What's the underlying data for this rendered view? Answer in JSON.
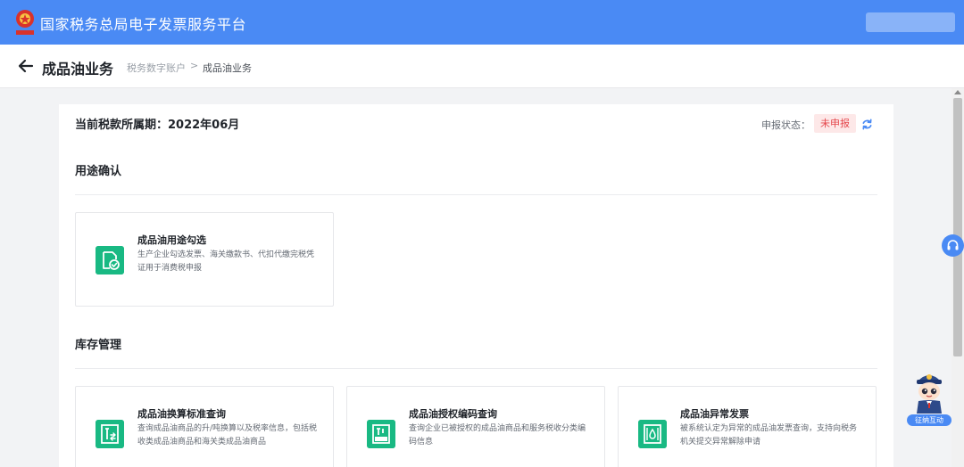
{
  "header": {
    "app_title": "国家税务总局电子发票服务平台"
  },
  "page": {
    "title": "成品油业务",
    "breadcrumb": [
      "税务数字账户",
      "成品油业务"
    ],
    "breadcrumb_separator": ">"
  },
  "main": {
    "period_text": "当前税款所属期：2022年06月",
    "status_label": "申报状态：",
    "status_value": "未申报",
    "sections": [
      {
        "title": "用途确认",
        "cards": [
          {
            "title": "成品油用途勾选",
            "desc": "生产企业勾选发票、海关缴款书、代扣代缴完税凭证用于消费税申报",
            "icon": "check-document-icon"
          }
        ]
      },
      {
        "title": "库存管理",
        "cards": [
          {
            "title": "成品油换算标准查询",
            "desc": "查询成品油商品的升/吨换算以及税率信息，包括税收类成品油商品和海关类成品油商品",
            "icon": "fuel-conversion-icon"
          },
          {
            "title": "成品油授权编码查询",
            "desc": "查询企业已被授权的成品油商品和服务税收分类编码信息",
            "icon": "fuel-code-icon"
          },
          {
            "title": "成品油异常发票",
            "desc": "被系统认定为异常的成品油发票查询，支持向税务机关提交异常解除申请",
            "icon": "fuel-abnormal-icon"
          }
        ]
      }
    ]
  },
  "widgets": {
    "assistant_label": "征纳互动"
  },
  "colors": {
    "brand_blue": "#4a8af4",
    "card_icon_green": "#19b983",
    "status_red": "#e5484d"
  }
}
